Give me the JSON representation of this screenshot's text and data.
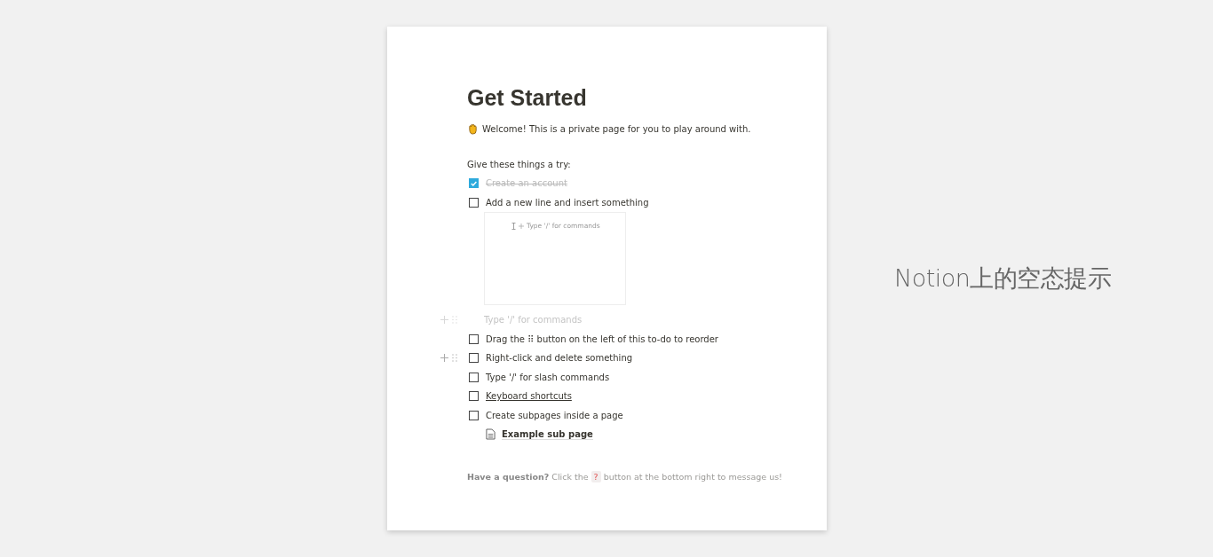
{
  "page": {
    "title": "Get Started",
    "welcome": "Welcome! This is a private page for you to play around with.",
    "intro": "Give these things a try:",
    "blocks": [
      {
        "kind": "todo",
        "text": "Create an account",
        "checked": true,
        "hovered": false,
        "link": false
      },
      {
        "kind": "todo",
        "text": "Add a new line and insert something",
        "checked": false,
        "hovered": false,
        "link": false
      },
      {
        "kind": "image",
        "text": "Type '/' for commands"
      },
      {
        "kind": "empty",
        "placeholder": "Type '/' for commands",
        "hovered": true
      },
      {
        "kind": "todo",
        "text": "Drag the ⠿ button on the left of this to-do to reorder",
        "checked": false,
        "hovered": false,
        "link": false
      },
      {
        "kind": "todo",
        "text": "Right-click and delete something",
        "checked": false,
        "hovered": true,
        "link": false
      },
      {
        "kind": "todo",
        "text": "Type '/' for slash commands",
        "checked": false,
        "hovered": false,
        "link": false
      },
      {
        "kind": "todo",
        "text": "Keyboard shortcuts",
        "checked": false,
        "hovered": false,
        "link": true
      },
      {
        "kind": "todo",
        "text": "Create subpages inside a page",
        "checked": false,
        "hovered": false,
        "link": false
      },
      {
        "kind": "subpage",
        "text": "Example sub page"
      }
    ],
    "help": {
      "before": "**Have a question?** Click the",
      "badge": "?",
      "after": "button at the bottom right to message us!"
    }
  },
  "caption": "Notion上的空态提示"
}
